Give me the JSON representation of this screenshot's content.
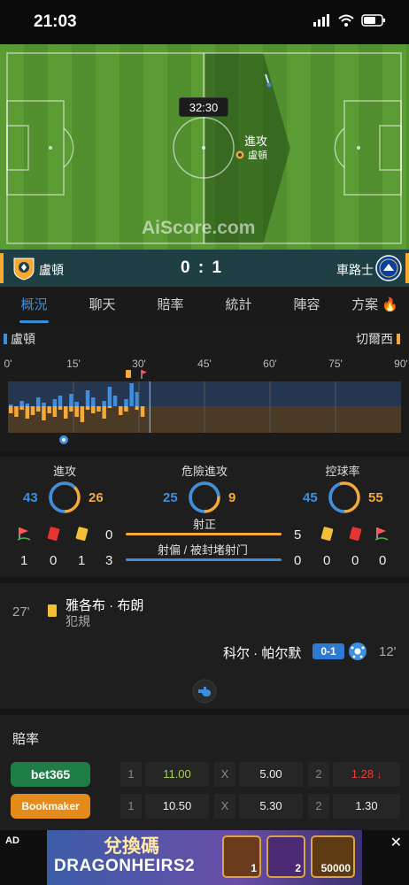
{
  "status_bar": {
    "time": "21:03"
  },
  "match": {
    "clock": "32:30",
    "attack_label": "進攻",
    "attacking_team": "盧頓",
    "watermark": "AiScore.com",
    "home_team": "盧頓",
    "away_team": "車路士",
    "score": "0 : 1"
  },
  "tabs": [
    {
      "label": "概況",
      "active": true
    },
    {
      "label": "聊天",
      "active": false
    },
    {
      "label": "賠率",
      "active": false
    },
    {
      "label": "統計",
      "active": false
    },
    {
      "label": "陣容",
      "active": false
    },
    {
      "label": "方案",
      "active": false
    }
  ],
  "timeline": {
    "home_label": "盧頓",
    "away_label": "切爾西",
    "minute_ticks": [
      "0'",
      "15'",
      "30'",
      "45'",
      "60'",
      "75'",
      "90'"
    ],
    "current_minute": 32.5
  },
  "stats": {
    "attacks": {
      "label": "進攻",
      "home": "43",
      "away": "26"
    },
    "dangerous_attacks": {
      "label": "危險進攻",
      "home": "25",
      "away": "9"
    },
    "possession": {
      "label": "控球率",
      "home": "45",
      "away": "55"
    },
    "on_target": {
      "label": "射正",
      "home": "0",
      "away": "5"
    },
    "off_target": {
      "label": "射偏 / 被封堵射门",
      "home": "3",
      "away": "0"
    },
    "home_cards": {
      "corners": "1",
      "red": "0",
      "yellow": "1"
    },
    "away_cards": {
      "yellow": "0",
      "red": "0",
      "corners": "0"
    }
  },
  "events": [
    {
      "minute": "27'",
      "player": "雅各布 · 布朗",
      "detail": "犯規",
      "side": "home",
      "type": "yellow-card"
    },
    {
      "minute": "12'",
      "player": "科尔 · 帕尔默",
      "score": "0-1",
      "side": "away",
      "type": "goal"
    }
  ],
  "odds": {
    "title": "賠率",
    "rows": [
      {
        "bookmaker": "bet365",
        "color": "#1f7d46",
        "label1": "1",
        "home": "11.00",
        "labelx": "X",
        "draw": "5.00",
        "label2": "2",
        "away": "1.28",
        "home_color": "#a8d14e",
        "away_color": "#ee3b3b",
        "away_trend": "down"
      },
      {
        "bookmaker": "Bookmaker",
        "color": "#e48b1c",
        "label1": "1",
        "home": "10.50",
        "labelx": "X",
        "draw": "5.30",
        "label2": "2",
        "away": "1.30",
        "home_color": "#eeeeee",
        "away_color": "#eeeeee",
        "away_trend": ""
      }
    ]
  },
  "ad": {
    "tag": "AD",
    "close": "✕",
    "title_cn": "兌換碼",
    "title_en": "DRAGONHEIRS2",
    "items": [
      "1",
      "2",
      "50000"
    ]
  }
}
